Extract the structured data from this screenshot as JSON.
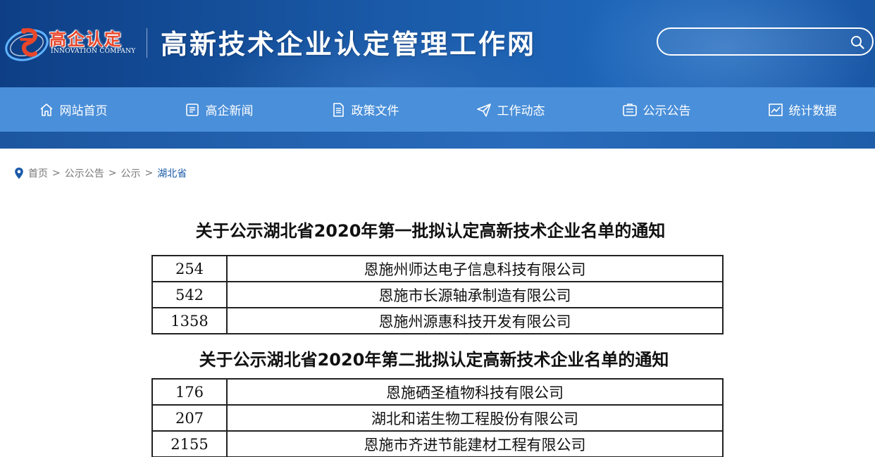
{
  "header": {
    "logo_cn": "高企认定",
    "logo_en": "INNOVATION COMPANY",
    "site_title": "高新技术企业认定管理工作网",
    "search": {
      "placeholder": "",
      "icon": "search-icon"
    }
  },
  "nav": {
    "items": [
      {
        "label": "网站首页",
        "icon": "home-icon"
      },
      {
        "label": "高企新闻",
        "icon": "news-icon"
      },
      {
        "label": "政策文件",
        "icon": "document-icon"
      },
      {
        "label": "工作动态",
        "icon": "send-icon"
      },
      {
        "label": "公示公告",
        "icon": "notice-icon"
      },
      {
        "label": "统计数据",
        "icon": "chart-icon"
      }
    ]
  },
  "breadcrumb": {
    "items": [
      "首页",
      "公示公告",
      "公示",
      "湖北省"
    ],
    "separator": ">"
  },
  "notices": [
    {
      "title": "关于公示湖北省2020年第一批拟认定高新技术企业名单的通知",
      "rows": [
        {
          "no": "254",
          "company": "恩施州师达电子信息科技有限公司"
        },
        {
          "no": "542",
          "company": "恩施市长源轴承制造有限公司"
        },
        {
          "no": "1358",
          "company": "恩施州源惠科技开发有限公司"
        }
      ]
    },
    {
      "title": "关于公示湖北省2020年第二批拟认定高新技术企业名单的通知",
      "rows": [
        {
          "no": "176",
          "company": "恩施硒圣植物科技有限公司"
        },
        {
          "no": "207",
          "company": "湖北和诺生物工程股份有限公司"
        },
        {
          "no": "2155",
          "company": "恩施市齐进节能建材工程有限公司"
        }
      ]
    }
  ],
  "colors": {
    "header_bg": "#1a5aa8",
    "nav_bg": "#4a8fd9",
    "logo_red": "#e8472b",
    "breadcrumb_current": "#1a5aa8"
  }
}
